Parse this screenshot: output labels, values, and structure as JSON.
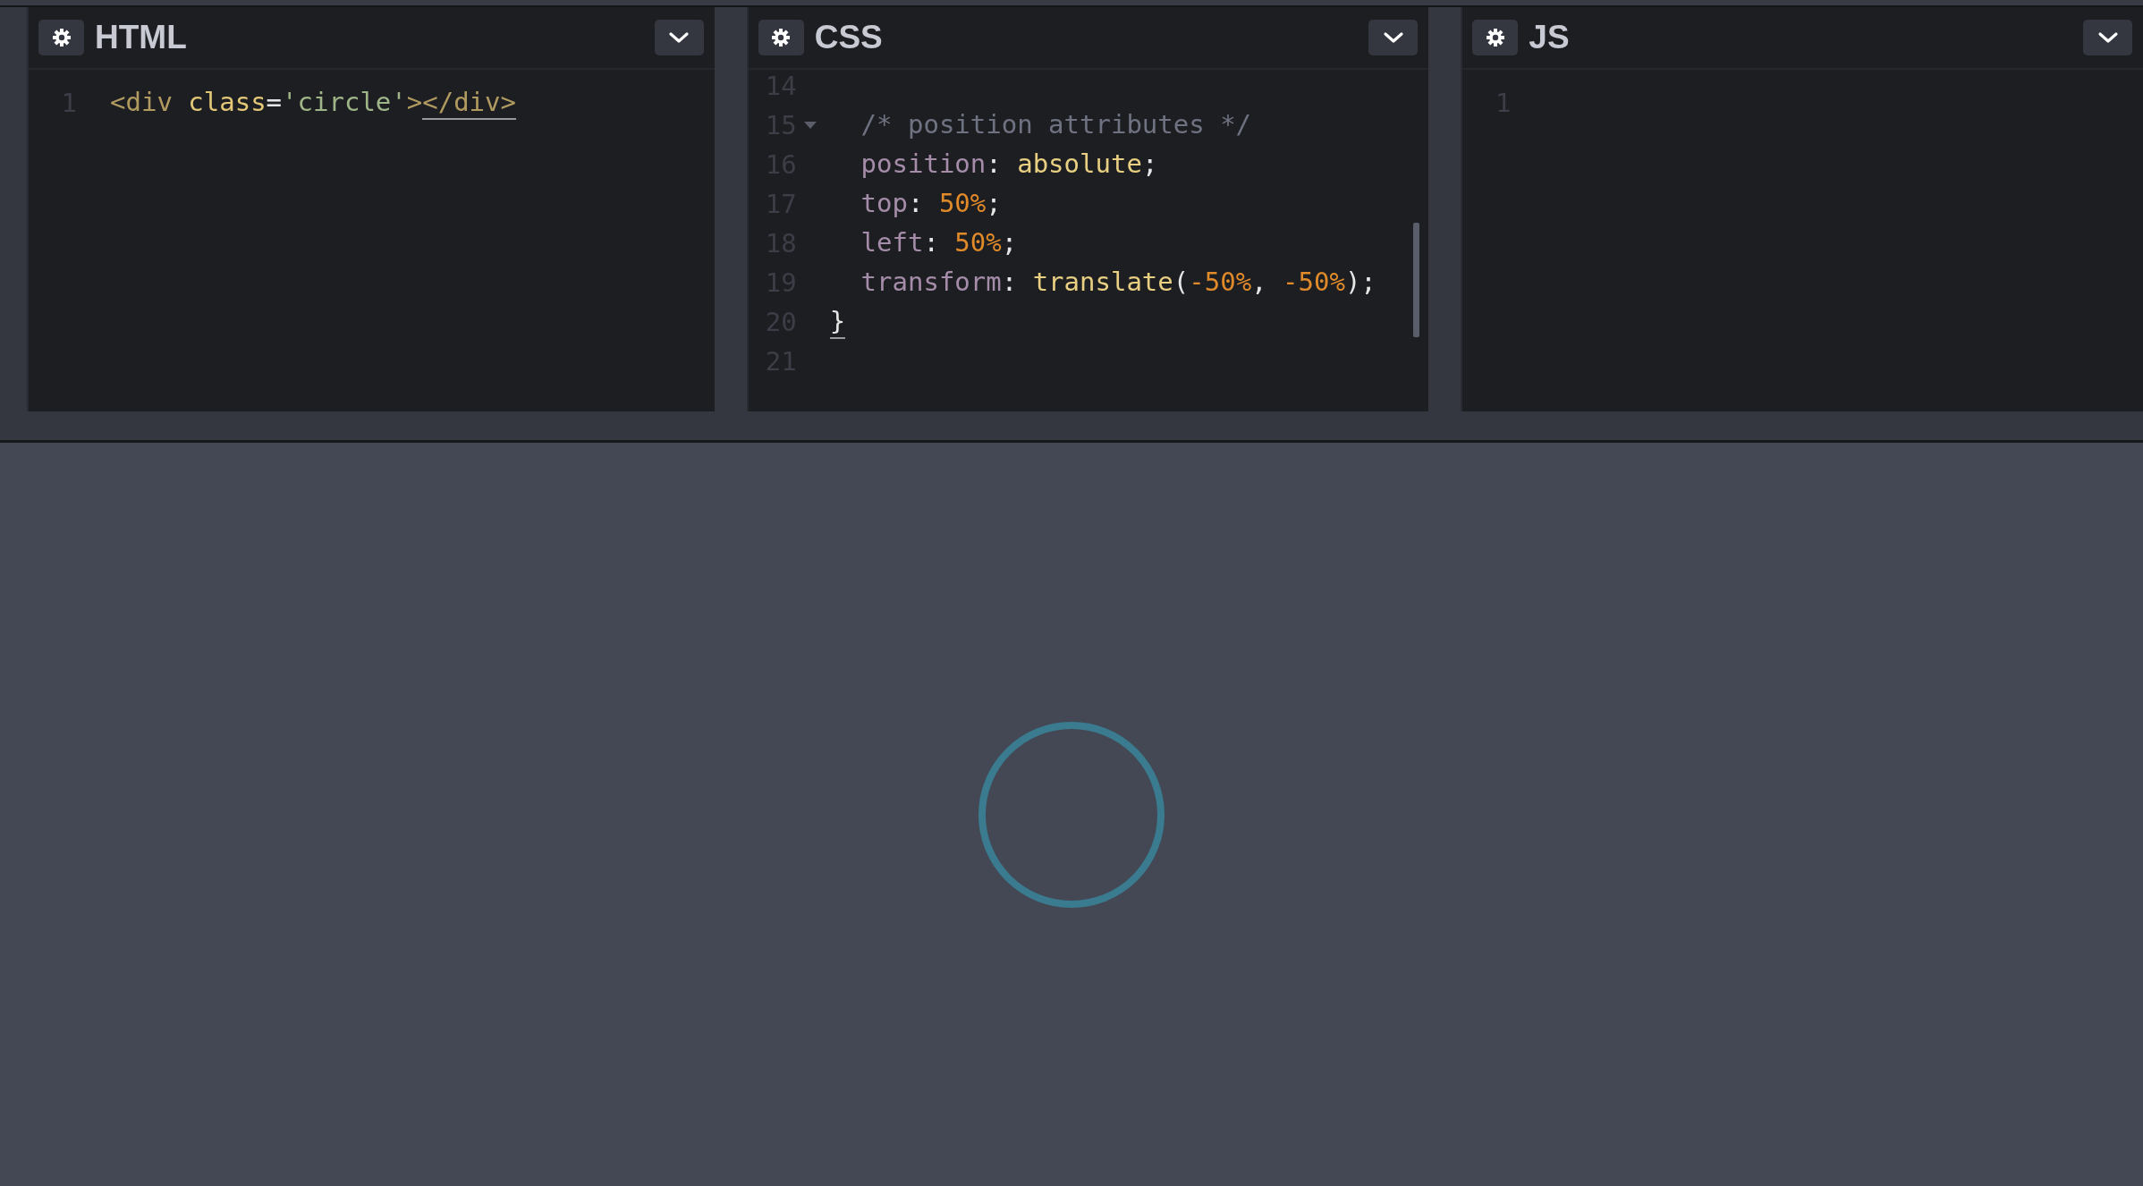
{
  "panels": [
    {
      "title": "HTML",
      "lines": [
        {
          "number": "1",
          "foldable": false,
          "tokens": [
            {
              "text": "<div",
              "kind": "tag",
              "matched": false
            },
            {
              "text": " class",
              "kind": "attr",
              "matched": false
            },
            {
              "text": "=",
              "kind": "punct",
              "matched": false
            },
            {
              "text": "'circle'",
              "kind": "string",
              "matched": false
            },
            {
              "text": ">",
              "kind": "tag",
              "matched": false
            },
            {
              "text": "</div>",
              "kind": "tag",
              "matched": true
            }
          ]
        }
      ]
    },
    {
      "title": "CSS",
      "lines": [
        {
          "number": "14",
          "foldable": false
        },
        {
          "number": "15",
          "foldable": true,
          "tokens": [
            {
              "text": "  /* position attributes */",
              "kind": "comment",
              "matched": false
            }
          ]
        },
        {
          "number": "16",
          "foldable": false,
          "tokens": [
            {
              "text": "  position",
              "kind": "property",
              "matched": false
            },
            {
              "text": ": ",
              "kind": "punct",
              "matched": false
            },
            {
              "text": "absolute",
              "kind": "value",
              "matched": false
            },
            {
              "text": ";",
              "kind": "punct",
              "matched": false
            }
          ]
        },
        {
          "number": "17",
          "foldable": false,
          "tokens": [
            {
              "text": "  top",
              "kind": "property",
              "matched": false
            },
            {
              "text": ": ",
              "kind": "punct",
              "matched": false
            },
            {
              "text": "50%",
              "kind": "number",
              "matched": false
            },
            {
              "text": ";",
              "kind": "punct",
              "matched": false
            }
          ]
        },
        {
          "number": "18",
          "foldable": false,
          "tokens": [
            {
              "text": "  left",
              "kind": "property",
              "matched": false
            },
            {
              "text": ": ",
              "kind": "punct",
              "matched": false
            },
            {
              "text": "50%",
              "kind": "number",
              "matched": false
            },
            {
              "text": ";",
              "kind": "punct",
              "matched": false
            }
          ]
        },
        {
          "number": "19",
          "foldable": false,
          "tokens": [
            {
              "text": "  transform",
              "kind": "property",
              "matched": false
            },
            {
              "text": ": ",
              "kind": "punct",
              "matched": false
            },
            {
              "text": "translate",
              "kind": "value",
              "matched": false
            },
            {
              "text": "(",
              "kind": "punct",
              "matched": false
            },
            {
              "text": "-50%",
              "kind": "number",
              "matched": false
            },
            {
              "text": ", ",
              "kind": "punct",
              "matched": false
            },
            {
              "text": "-50%",
              "kind": "number",
              "matched": false
            },
            {
              "text": ");",
              "kind": "punct",
              "matched": false
            }
          ]
        },
        {
          "number": "20",
          "foldable": false,
          "tokens": [
            {
              "text": "}",
              "kind": "punct",
              "matched": true
            }
          ]
        },
        {
          "number": "21",
          "foldable": false
        }
      ]
    },
    {
      "title": "JS",
      "lines": [
        {
          "number": "1",
          "foldable": false
        }
      ]
    }
  ]
}
